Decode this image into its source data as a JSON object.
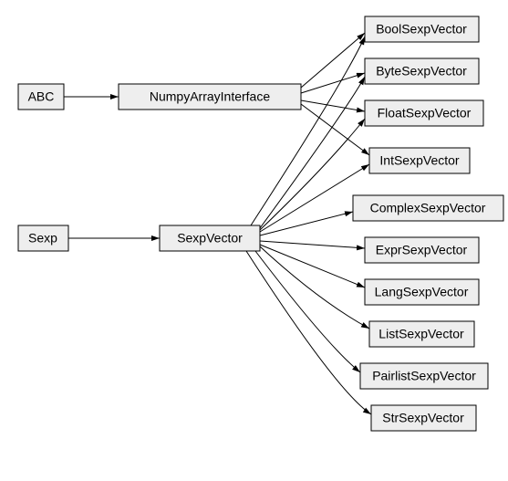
{
  "nodes": {
    "abc": "ABC",
    "numpy": "NumpyArrayInterface",
    "sexp": "Sexp",
    "sexpVector": "SexpVector",
    "bool": "BoolSexpVector",
    "byte": "ByteSexpVector",
    "float": "FloatSexpVector",
    "int": "IntSexpVector",
    "complex": "ComplexSexpVector",
    "expr": "ExprSexpVector",
    "lang": "LangSexpVector",
    "list": "ListSexpVector",
    "pairlist": "PairlistSexpVector",
    "str": "StrSexpVector"
  }
}
